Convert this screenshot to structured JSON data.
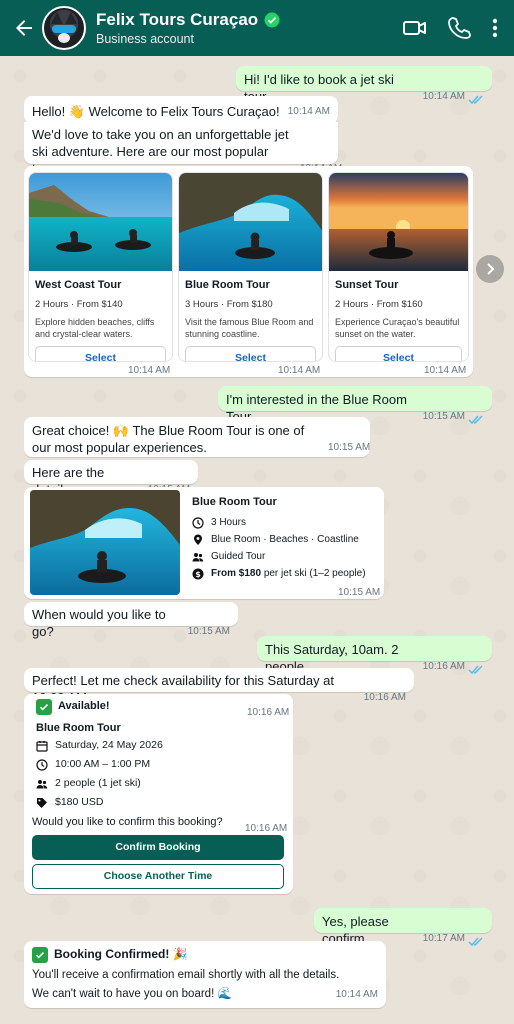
{
  "header": {
    "title": "Felix Tours Curaçao",
    "subtitle": "Business account",
    "accent": "#075e54"
  },
  "messages": {
    "m1": {
      "text": "Hi! I'd like to book a jet ski tour.",
      "time": "10:14 AM"
    },
    "m2": {
      "text": "Hello! 👋 Welcome to Felix Tours Curaçao!",
      "time": "10:14 AM"
    },
    "m3": {
      "text": "We'd love to take you on an unforgettable jet ski adventure. Here are our most popular tours:",
      "time": "10:14 AM"
    },
    "carousel_time": "10:14 AM",
    "m4": {
      "text": "I'm interested in the Blue Room Tour.",
      "time": "10:15 AM"
    },
    "m5": {
      "text": "Great choice! 🙌 The Blue Room Tour is one of our most popular experiences.",
      "time": "10:15 AM"
    },
    "m6": {
      "text": "Here are the details:",
      "time": "10:15 AM"
    },
    "m7": {
      "text": "When would you like to go?",
      "time": "10:15 AM"
    },
    "m8": {
      "text": "This Saturday, 10am. 2 people.",
      "time": "10:16 AM"
    },
    "m9": {
      "text": "Perfect! Let me check availability for this Saturday at 10:00 AM...",
      "time": "10:16 AM"
    },
    "m10": {
      "text": "Yes, please confirm.",
      "time": "10:17 AM"
    }
  },
  "tours": [
    {
      "title": "West Coast Tour",
      "meta": "2 Hours · From $140",
      "desc": "Explore hidden beaches, cliffs and crystal-clear waters.",
      "button": "Select"
    },
    {
      "title": "Blue Room Tour",
      "meta": "3 Hours · From $180",
      "desc": "Visit the famous Blue Room and stunning coastline.",
      "button": "Select"
    },
    {
      "title": "Sunset Tour",
      "meta": "2 Hours · From $160",
      "desc": "Experience Curaçao's beautiful sunset on the water.",
      "button": "Select"
    }
  ],
  "details_card": {
    "title": "Blue Room Tour",
    "duration": "3 Hours",
    "route": "Blue Room · Beaches · Coastline",
    "guide": "Guided Tour",
    "price_bold": "From $180",
    "price_rest": "per jet ski (1–2 people)",
    "time": "10:15 AM"
  },
  "availability": {
    "status": "Available!",
    "time": "10:16 AM",
    "tour": "Blue Room Tour",
    "date": "Saturday, 24 May 2026",
    "hours": "10:00 AM – 1:00 PM",
    "people": "2 people (1 jet ski)",
    "price": "$180 USD",
    "question": "Would you like to confirm this booking?",
    "question_time": "10:16 AM",
    "confirm_button": "Confirm Booking",
    "other_button": "Choose Another Time"
  },
  "confirmation": {
    "title": "Booking Confirmed! 🎉",
    "line1": "You'll receive a confirmation email shortly with all the details.",
    "line2": "We can't wait to have you on board! 🌊",
    "time": "10:14 AM"
  }
}
